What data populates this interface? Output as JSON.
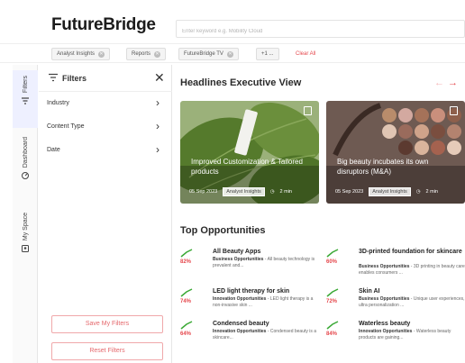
{
  "header": {
    "logo": "FutureBridge",
    "search_placeholder": "Enter keyword e.g. Mobility Cloud"
  },
  "chips": {
    "items": [
      "Analyst Insights",
      "Reports",
      "FutureBridge TV",
      "+1 ..."
    ],
    "clear_all": "Clear All"
  },
  "rail": {
    "filters": "Filters",
    "dashboard": "Dashboard",
    "my_space": "My Space"
  },
  "filters": {
    "title": "Filters",
    "rows": [
      "Industry",
      "Content Type",
      "Date"
    ],
    "save_button": "Save My Filters",
    "reset_button": "Reset Filters"
  },
  "headlines": {
    "title": "Headlines Executive View",
    "cards": [
      {
        "title": "Improved Customization & Tailored products",
        "date": "05 Sep 2023",
        "tag": "Analyst Insights",
        "read": "2 min"
      },
      {
        "title": "Big beauty incubates its own disruptors (M&A)",
        "date": "05 Sep 2023",
        "tag": "Analyst Insights",
        "read": "2 min"
      }
    ]
  },
  "opportunities": {
    "title": "Top Opportunities",
    "items": [
      {
        "name": "All Beauty Apps",
        "category": "Business Opportunities",
        "desc": "All beauty technology is prevalent and...",
        "pct": "82%"
      },
      {
        "name": "3D-printed foundation for skincare",
        "category": "Business Opportunities",
        "desc": "3D printing in beauty care enables consumers ...",
        "pct": "60%"
      },
      {
        "name": "LED light therapy for skin",
        "category": "Innovation Opportunities",
        "desc": "LED light therapy is a non-invasive skin ...",
        "pct": "74%"
      },
      {
        "name": "Skin AI",
        "category": "Business Opportunities",
        "desc": "Unique user experiences, ultra personalization ...",
        "pct": "72%"
      },
      {
        "name": "Condensed beauty",
        "category": "Innovation Opportunities",
        "desc": "Condensed beauty is a skincare...",
        "pct": "64%"
      },
      {
        "name": "Waterless beauty",
        "category": "Innovation Opportunities",
        "desc": "Waterless beauty products are gaining...",
        "pct": "84%"
      }
    ]
  },
  "colors": {
    "accent": "#e5484d",
    "trend": "#3aa935"
  }
}
